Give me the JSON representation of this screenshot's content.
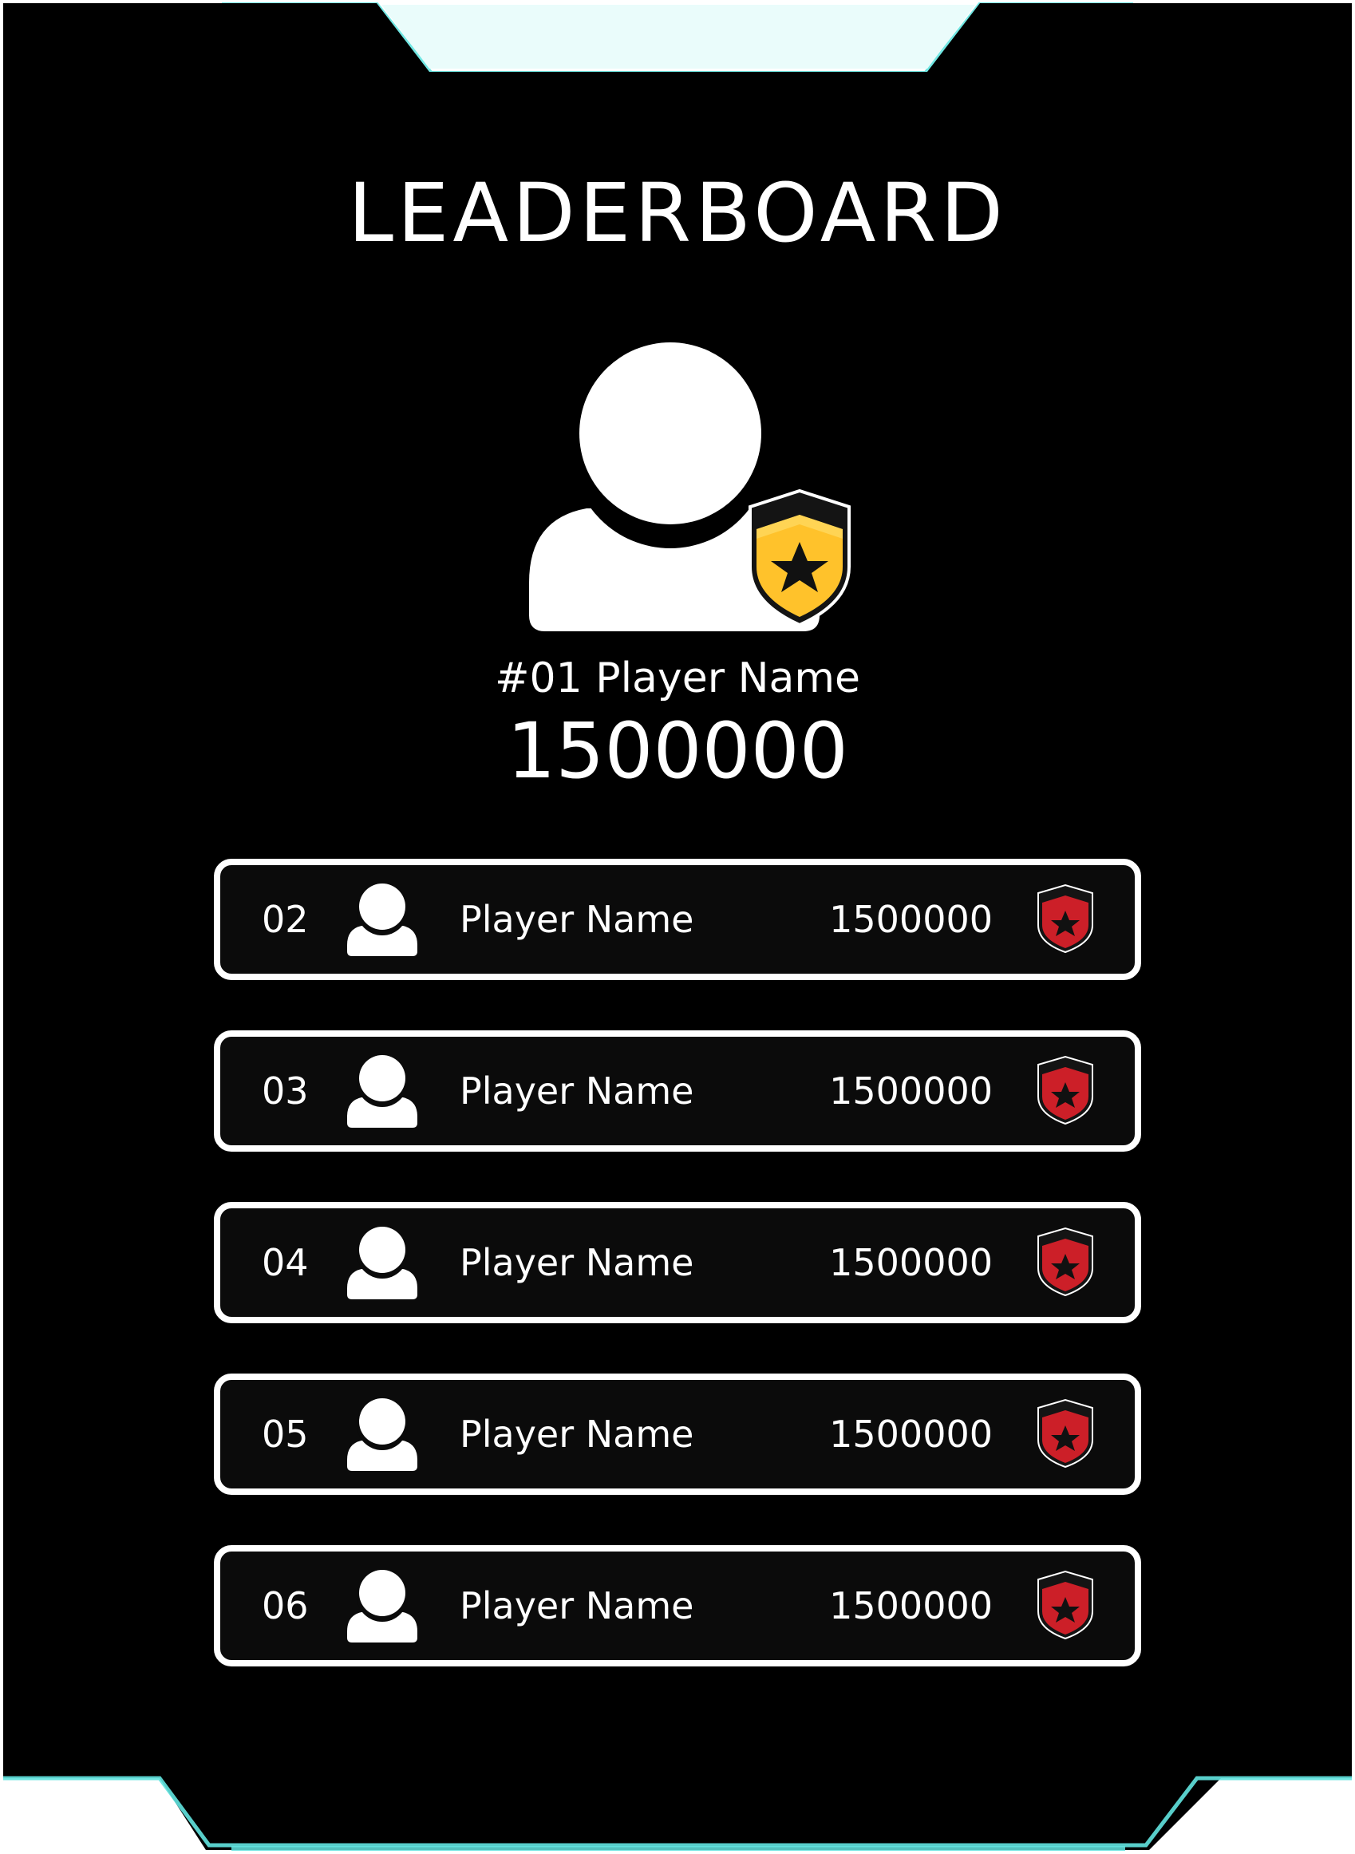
{
  "title": "LEADERBOARD",
  "colors": {
    "background": "#000000",
    "frame_accent": "#62e4e0",
    "gold_badge": "#ffc22b",
    "red_badge": "#cc1f28",
    "text": "#ffffff"
  },
  "top_player": {
    "name": "#01 Player Name",
    "score": "1500000",
    "avatar_icon": "user-icon",
    "badge_icon": "gold-star-shield-icon"
  },
  "rows": [
    {
      "rank": "02",
      "name": "Player Name",
      "score": "1500000",
      "badge_icon": "red-star-shield-icon"
    },
    {
      "rank": "03",
      "name": "Player Name",
      "score": "1500000",
      "badge_icon": "red-star-shield-icon"
    },
    {
      "rank": "04",
      "name": "Player Name",
      "score": "1500000",
      "badge_icon": "red-star-shield-icon"
    },
    {
      "rank": "05",
      "name": "Player Name",
      "score": "1500000",
      "badge_icon": "red-star-shield-icon"
    },
    {
      "rank": "06",
      "name": "Player Name",
      "score": "1500000",
      "badge_icon": "red-star-shield-icon"
    }
  ]
}
